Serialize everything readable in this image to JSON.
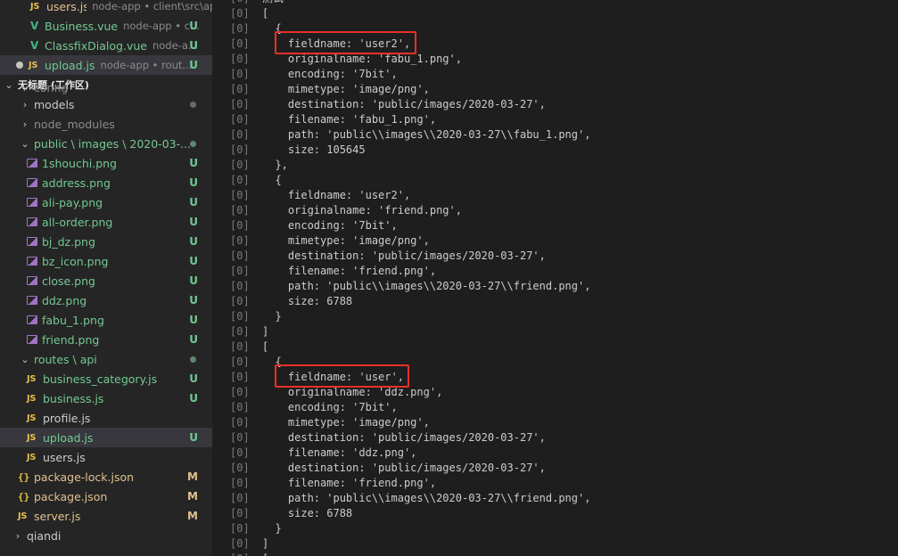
{
  "sidebar": {
    "open_editors": [
      {
        "icon": "js",
        "name": "users.js",
        "desc": "node-app • client\\src\\api",
        "status": "",
        "color": "yellow"
      },
      {
        "icon": "vue",
        "name": "Business.vue",
        "desc": "node-app • c...",
        "status": "U",
        "color": "green"
      },
      {
        "icon": "vue",
        "name": "ClassfixDialog.vue",
        "desc": "node-a...",
        "status": "U",
        "color": "green"
      },
      {
        "icon": "js",
        "name": "upload.js",
        "desc": "node-app • rout...",
        "status": "U",
        "color": "green",
        "dirty": true
      }
    ],
    "workspace_title": "无标题 (工作区)",
    "tree": [
      {
        "kind": "folder",
        "name": "config",
        "collapsed": true,
        "color": "dim",
        "partial": true
      },
      {
        "kind": "folder",
        "name": "models",
        "collapsed": true,
        "color": "norm",
        "marker": "dot-dim"
      },
      {
        "kind": "folder",
        "name": "node_modules",
        "collapsed": true,
        "color": "dim"
      },
      {
        "kind": "folder",
        "name": "public \\ images \\ 2020-03-...",
        "collapsed": false,
        "color": "green",
        "marker": "dot-green"
      },
      {
        "kind": "img",
        "name": "1shouchi.png",
        "status": "U"
      },
      {
        "kind": "img",
        "name": "address.png",
        "status": "U"
      },
      {
        "kind": "img",
        "name": "ali-pay.png",
        "status": "U"
      },
      {
        "kind": "img",
        "name": "all-order.png",
        "status": "U"
      },
      {
        "kind": "img",
        "name": "bj_dz.png",
        "status": "U"
      },
      {
        "kind": "img",
        "name": "bz_icon.png",
        "status": "U"
      },
      {
        "kind": "img",
        "name": "close.png",
        "status": "U"
      },
      {
        "kind": "img",
        "name": "ddz.png",
        "status": "U"
      },
      {
        "kind": "img",
        "name": "fabu_1.png",
        "status": "U"
      },
      {
        "kind": "img",
        "name": "friend.png",
        "status": "U"
      },
      {
        "kind": "folder",
        "name": "routes \\ api",
        "collapsed": false,
        "color": "green",
        "marker": "dot-green"
      },
      {
        "kind": "js",
        "name": "business_category.js",
        "status": "U",
        "color": "green"
      },
      {
        "kind": "js",
        "name": "business.js",
        "status": "U",
        "color": "green"
      },
      {
        "kind": "js",
        "name": "profile.js",
        "status": "",
        "color": "norm"
      },
      {
        "kind": "js",
        "name": "upload.js",
        "status": "U",
        "color": "green",
        "selected": true
      },
      {
        "kind": "js",
        "name": "users.js",
        "status": "",
        "color": "norm"
      },
      {
        "kind": "json",
        "name": "package-lock.json",
        "status": "M",
        "color": "yellow"
      },
      {
        "kind": "json",
        "name": "package.json",
        "status": "M",
        "color": "yellow"
      },
      {
        "kind": "js",
        "name": "server.js",
        "status": "M",
        "color": "yellow"
      },
      {
        "kind": "folder",
        "name": "qiandi",
        "collapsed": true,
        "color": "norm"
      }
    ]
  },
  "terminal": {
    "prefix": "[0]",
    "lines": [
      "测试",
      "[",
      "  {",
      "    fieldname: 'user2',",
      "    originalname: 'fabu_1.png',",
      "    encoding: '7bit',",
      "    mimetype: 'image/png',",
      "    destination: 'public/images/2020-03-27',",
      "    filename: 'fabu_1.png',",
      "    path: 'public\\\\images\\\\2020-03-27\\\\fabu_1.png',",
      "    size: 105645",
      "  },",
      "  {",
      "    fieldname: 'user2',",
      "    originalname: 'friend.png',",
      "    encoding: '7bit',",
      "    mimetype: 'image/png',",
      "    destination: 'public/images/2020-03-27',",
      "    filename: 'friend.png',",
      "    path: 'public\\\\images\\\\2020-03-27\\\\friend.png',",
      "    size: 6788",
      "  }",
      "]",
      "[",
      "  {",
      "    fieldname: 'user',",
      "    originalname: 'ddz.png',",
      "    encoding: '7bit',",
      "    mimetype: 'image/png',",
      "    destination: 'public/images/2020-03-27',",
      "    filename: 'ddz.png',",
      "    destination: 'public/images/2020-03-27',",
      "    filename: 'friend.png',",
      "    path: 'public\\\\images\\\\2020-03-27\\\\friend.png',",
      "    size: 6788",
      "  }",
      "]",
      "["
    ],
    "highlighted_lines": [
      3,
      25
    ],
    "highlight_color": "#e8302a"
  },
  "colors": {
    "sidebar_bg": "#252526",
    "terminal_bg": "#1e1e1e",
    "untracked_green": "#73c991",
    "modified_yellow": "#e2c08d"
  }
}
